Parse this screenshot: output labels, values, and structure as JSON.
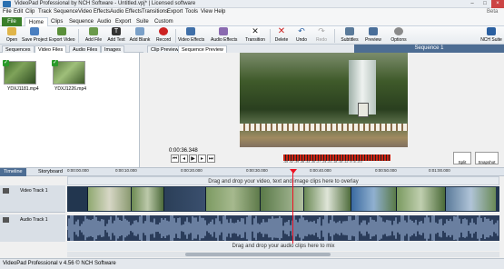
{
  "window": {
    "title": "VideoPad Professional by NCH Software - Untitled.vpj* | Licensed software",
    "edition": "Beta"
  },
  "menu": [
    "File",
    "Edit",
    "Clip",
    "Track",
    "Sequence",
    "Video Effects",
    "Audio Effects",
    "Transitions",
    "Export",
    "Tools",
    "View",
    "Help"
  ],
  "ribbon_tabs": [
    "File",
    "Home",
    "Clips",
    "Sequence",
    "Audio",
    "Export",
    "Suite",
    "Custom"
  ],
  "ribbon_active": "Home",
  "toolbar": {
    "open": "Open",
    "save_project": "Save Project",
    "export_video": "Export Video",
    "add_file": "Add File",
    "add_text": "Add Text",
    "add_blank": "Add Blank",
    "record": "Record",
    "video_effects": "Video Effects",
    "audio_effects": "Audio Effects",
    "transition": "Transition",
    "delete": "Delete",
    "undo": "Undo",
    "redo": "Redo",
    "subtitles": "Subtitles",
    "preview": "Preview",
    "options": "Options",
    "nch_suite": "NCH Suite"
  },
  "clip_tabs": [
    "Sequences",
    "Video Files",
    "Audio Files",
    "Images"
  ],
  "clip_active": "Video Files",
  "clips": [
    {
      "name": "YDXJ1181.mp4"
    },
    {
      "name": "YDXJ1226.mp4"
    }
  ],
  "preview_tabs": [
    "Clip Preview",
    "Sequence Preview"
  ],
  "preview_active": "Sequence Preview",
  "sequence_title": "Sequence 1",
  "timecode": "0:00:36.348",
  "meter_labels": "-45 -42 -39 -36 -33 -30 -27 -24 -21 -18 -15 -12 -9 -6 -3 0",
  "preview_buttons": {
    "split": "Split",
    "snapshot": "Snapshot"
  },
  "timeline_tabs": [
    "Timeline",
    "Storyboard"
  ],
  "ruler_ticks": [
    "0:00:00.000",
    "0:00:10.000",
    "0:00:20.000",
    "0:00:30.000",
    "0:00:40.000",
    "0:00:50.000",
    "0:01:00.000"
  ],
  "overlay_hint": "Drag and drop your video, text and image clips here to overlay",
  "video_track_label": "Video Track 1",
  "audio_track_label": "Audio Track 1",
  "audio_hint": "Drag and drop your audio clips here to mix",
  "status": "VideoPad Professional v 4.56 © NCH Software",
  "colors": {
    "file_tab": "#3a7f2a",
    "sequence_header": "#4d6d93",
    "playhead": "#e12222",
    "track_bg": "#22364f"
  }
}
